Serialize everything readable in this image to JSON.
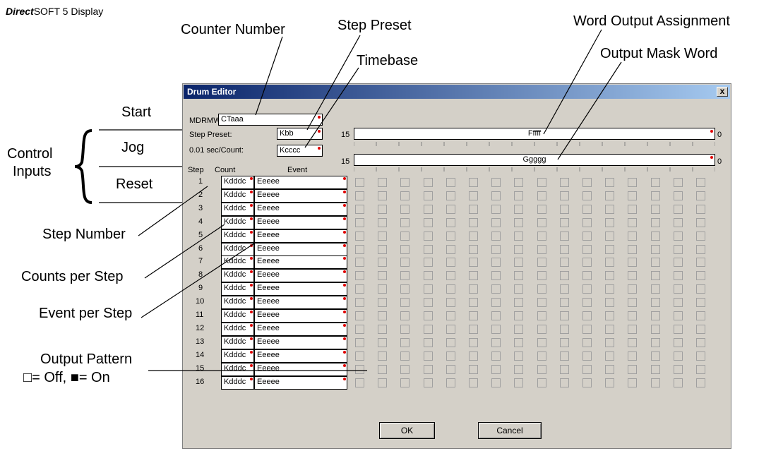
{
  "brand": {
    "strong": "Direct",
    "rest": "SOFT 5 Display"
  },
  "callouts": {
    "counter_number": "Counter Number",
    "step_preset": "Step Preset",
    "timebase": "Timebase",
    "word_output_assignment": "Word Output Assignment",
    "output_mask_word": "Output Mask Word",
    "step_number": "Step Number",
    "counts_per_step": "Counts per Step",
    "event_per_step": "Event per Step",
    "output_pattern_line1": "Output Pattern",
    "output_pattern_line2": "□= Off, ■= On"
  },
  "control_inputs": {
    "group_label_1": "Control",
    "group_label_2": "Inputs",
    "start": "Start",
    "jog": "Jog",
    "reset": "Reset"
  },
  "dialog": {
    "title": "Drum Editor",
    "close": "x",
    "mdrmw_label": "MDRMW",
    "mdrmw_value": "CTaaa",
    "step_preset_label": "Step Preset:",
    "step_preset_value": "Kbb",
    "timebase_label": "0.01 sec/Count:",
    "timebase_value": "Kcccc",
    "word_output": {
      "msb": "15",
      "value": "Fffff",
      "lsb": "0"
    },
    "mask_word": {
      "msb": "15",
      "value": "Ggggg",
      "lsb": "0"
    },
    "columns": {
      "step": "Step",
      "count": "Count",
      "event": "Event"
    },
    "steps": [
      {
        "n": "1",
        "count": "Kdddc",
        "event": "Eeeee"
      },
      {
        "n": "2",
        "count": "Kdddc",
        "event": "Eeeee"
      },
      {
        "n": "3",
        "count": "Kdddc",
        "event": "Eeeee"
      },
      {
        "n": "4",
        "count": "Kdddc",
        "event": "Eeeee"
      },
      {
        "n": "5",
        "count": "Kdddc",
        "event": "Eeeee"
      },
      {
        "n": "6",
        "count": "Kdddc",
        "event": "Eeeee"
      },
      {
        "n": "7",
        "count": "Kdddc",
        "event": "Eeeee"
      },
      {
        "n": "8",
        "count": "Kdddc",
        "event": "Eeeee"
      },
      {
        "n": "9",
        "count": "Kdddc",
        "event": "Eeeee"
      },
      {
        "n": "10",
        "count": "Kdddc",
        "event": "Eeeee"
      },
      {
        "n": "11",
        "count": "Kdddc",
        "event": "Eeeee"
      },
      {
        "n": "12",
        "count": "Kdddc",
        "event": "Eeeee"
      },
      {
        "n": "13",
        "count": "Kdddc",
        "event": "Eeeee"
      },
      {
        "n": "14",
        "count": "Kdddc",
        "event": "Eeeee"
      },
      {
        "n": "15",
        "count": "Kdddc",
        "event": "Eeeee"
      },
      {
        "n": "16",
        "count": "Kdddc",
        "event": "Eeeee"
      }
    ],
    "output_bits_per_step": 16,
    "ok_label": "OK",
    "cancel_label": "Cancel"
  },
  "colors": {
    "required_dot": "#e00000",
    "dialog_bg": "#d4d0c8",
    "title_start": "#0a246a",
    "title_end": "#a6caf0"
  }
}
